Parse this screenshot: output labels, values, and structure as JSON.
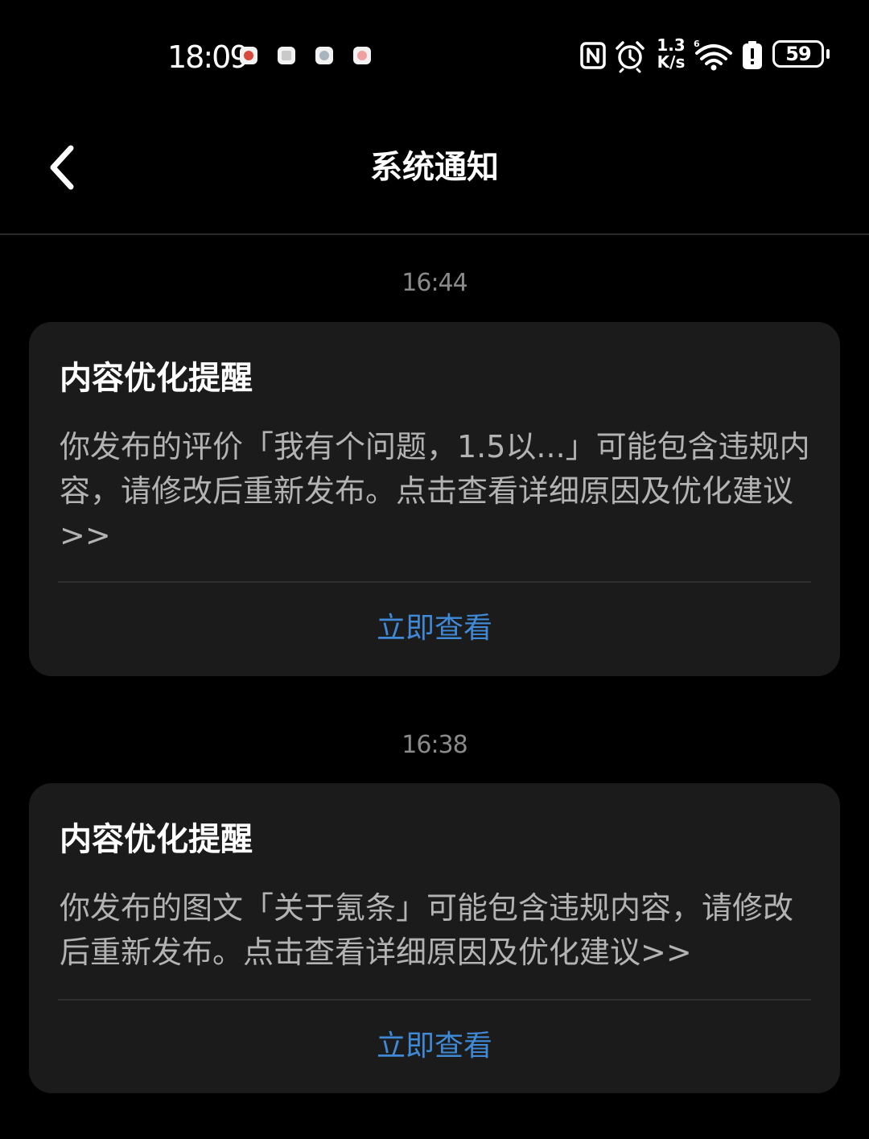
{
  "status_bar": {
    "time": "18:09",
    "network_speed_value": "1.3",
    "network_speed_unit": "K/s",
    "battery_level": "59",
    "notification_icons": [
      "app-notification-icon-1",
      "app-notification-icon-2",
      "app-notification-icon-3",
      "app-notification-icon-4"
    ],
    "icons": [
      "nfc-icon",
      "alarm-icon",
      "wifi-icon",
      "battery-warning-icon",
      "battery-icon"
    ]
  },
  "header": {
    "title": "系统通知",
    "back_icon": "chevron-left-icon"
  },
  "notifications": [
    {
      "time": "16:44",
      "title": "内容优化提醒",
      "body": "你发布的评价「我有个问题，1.5以...」可能包含违规内容，请修改后重新发布。点击查看详细原因及优化建议>>",
      "action_label": "立即查看"
    },
    {
      "time": "16:38",
      "title": "内容优化提醒",
      "body": "你发布的图文「关于氪条」可能包含违规内容，请修改后重新发布。点击查看详细原因及优化建议>>",
      "action_label": "立即查看"
    }
  ],
  "colors": {
    "background": "#000000",
    "card": "#1b1b1b",
    "title_text": "#ffffff",
    "body_text": "#b3b3b3",
    "timestamp_text": "#8a8a8a",
    "action_link": "#3f89d6"
  }
}
